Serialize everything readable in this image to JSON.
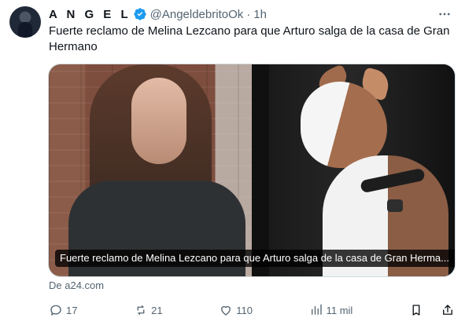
{
  "user": {
    "display_name": "A N G E L",
    "handle": "@AngeldebritoOk",
    "separator": "·",
    "time": "1h"
  },
  "tweet": {
    "text": "Fuerte reclamo de Melina Lezcano para que Arturo salga de la casa de Gran Hermano"
  },
  "media": {
    "caption": "Fuerte reclamo de Melina Lezcano para que Arturo salga de la casa de Gran Herma..."
  },
  "source": {
    "label": "De a24.com"
  },
  "actions": {
    "reply_count": "17",
    "retweet_count": "21",
    "like_count": "110",
    "views_count": "11 mil"
  },
  "icons": {
    "verified": "verified-badge-icon",
    "more": "more-horizontal-icon",
    "reply": "reply-icon",
    "retweet": "retweet-icon",
    "like": "like-icon",
    "views": "views-icon",
    "bookmark": "bookmark-icon",
    "share": "share-icon"
  },
  "colors": {
    "verified_blue": "#1d9bf0",
    "secondary_text": "#536471",
    "primary_text": "#0f1419"
  }
}
